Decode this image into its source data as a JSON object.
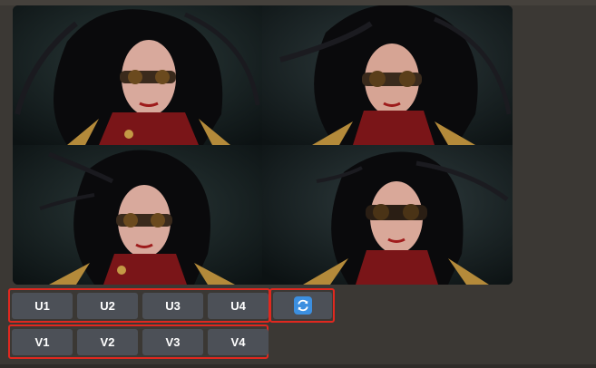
{
  "upscale_buttons": [
    {
      "label": "U1"
    },
    {
      "label": "U2"
    },
    {
      "label": "U3"
    },
    {
      "label": "U4"
    }
  ],
  "variation_buttons": [
    {
      "label": "V1"
    },
    {
      "label": "V2"
    },
    {
      "label": "V3"
    },
    {
      "label": "V4"
    }
  ],
  "reroll_button": {
    "icon": "refresh-icon"
  },
  "colors": {
    "background": "#3b3834",
    "button": "#4c5057",
    "highlight_border": "#e0281f",
    "refresh_icon": "#3c8fe0"
  }
}
